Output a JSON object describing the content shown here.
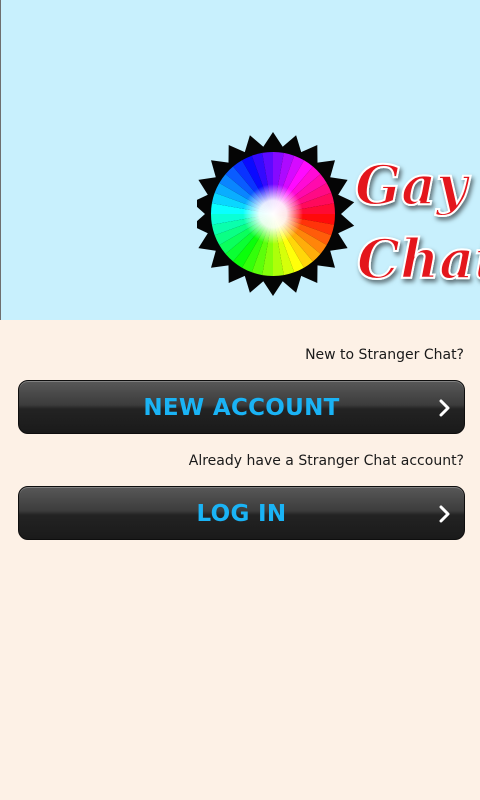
{
  "banner": {
    "logo_text_line1": "Gay",
    "logo_text_line2": "Chat",
    "background_color": "#c8f0fd"
  },
  "main": {
    "new_prompt": "New to Stranger Chat?",
    "new_account_button": "NEW ACCOUNT",
    "existing_prompt": "Already have a Stranger Chat account?",
    "login_button": "LOG IN",
    "button_text_color": "#1ab3f5",
    "background_color": "#fdf1e6"
  },
  "icons": {
    "button_chevron": "chevron-right-icon"
  }
}
